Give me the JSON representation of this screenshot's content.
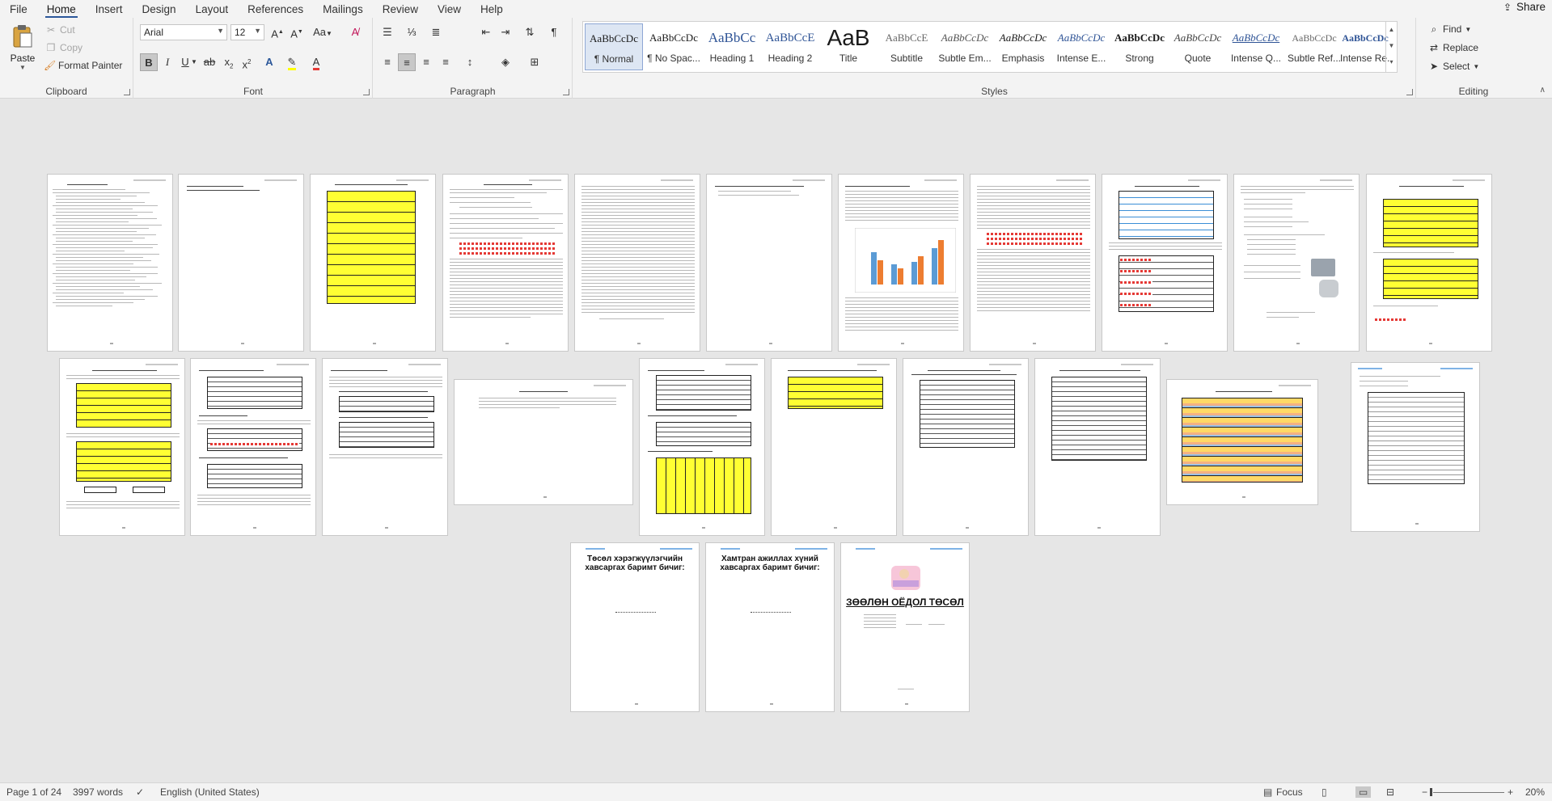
{
  "menu": {
    "tabs": [
      "File",
      "Home",
      "Insert",
      "Design",
      "Layout",
      "References",
      "Mailings",
      "Review",
      "View",
      "Help"
    ],
    "active_tab": "Home",
    "share_label": "Share"
  },
  "clipboard": {
    "label": "Clipboard",
    "paste": "Paste",
    "cut": "Cut",
    "copy": "Copy",
    "format_painter": "Format Painter"
  },
  "font": {
    "label": "Font",
    "family": "Arial",
    "size": "12",
    "aa_label": "Aa"
  },
  "paragraph": {
    "label": "Paragraph"
  },
  "styles": {
    "label": "Styles",
    "items": [
      {
        "sample": "AaBbCcDc",
        "name": "¶ Normal"
      },
      {
        "sample": "AaBbCcDc",
        "name": "¶ No Spac..."
      },
      {
        "sample": "AaBbCc",
        "name": "Heading 1"
      },
      {
        "sample": "AaBbCcE",
        "name": "Heading 2"
      },
      {
        "sample": "AaB",
        "name": "Title"
      },
      {
        "sample": "AaBbCcE",
        "name": "Subtitle"
      },
      {
        "sample": "AaBbCcDc",
        "name": "Subtle Em..."
      },
      {
        "sample": "AaBbCcDc",
        "name": "Emphasis"
      },
      {
        "sample": "AaBbCcDc",
        "name": "Intense E..."
      },
      {
        "sample": "AaBbCcDc",
        "name": "Strong"
      },
      {
        "sample": "AaBbCcDc",
        "name": "Quote"
      },
      {
        "sample": "AaBbCcDc",
        "name": "Intense Q..."
      },
      {
        "sample": "AaBbCcDc",
        "name": "Subtle Ref..."
      },
      {
        "sample": "AaBbCcDc",
        "name": "Intense Re..."
      }
    ]
  },
  "editing": {
    "label": "Editing",
    "find": "Find",
    "replace": "Replace",
    "select": "Select"
  },
  "pages": {
    "cover_1": "Төсөл хэрэгжүүлэгчийн хавсаргах баримт бичиг:",
    "cover_2": "Хамтран ажиллах хүний хавсаргах баримт бичиг:",
    "cover_3": "ЗӨӨЛӨН ОЁДОЛ ТӨСӨЛ"
  },
  "status": {
    "page": "Page 1 of 24",
    "words": "3997 words",
    "language": "English (United States)",
    "focus": "Focus",
    "zoom": "20%"
  }
}
